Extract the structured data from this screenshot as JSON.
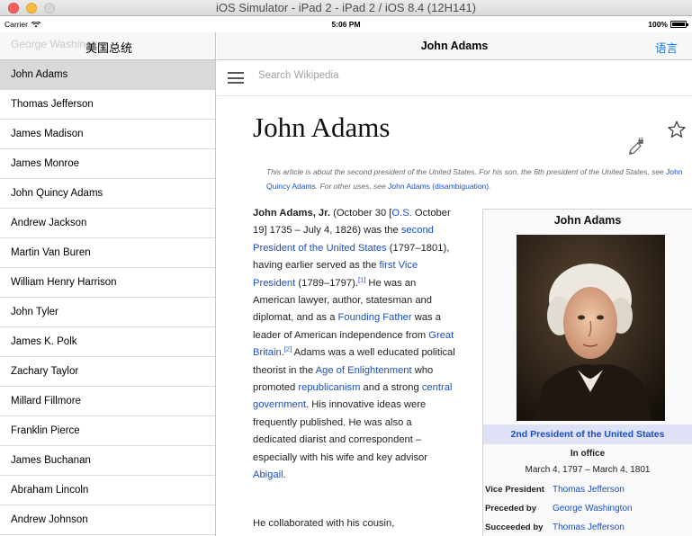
{
  "window": {
    "title": "iOS Simulator - iPad 2 - iPad 2 / iOS 8.4 (12H141)"
  },
  "status_bar": {
    "carrier": "Carrier",
    "time": "5:06 PM",
    "battery": "100%",
    "battery_level": 1.0
  },
  "master": {
    "back_title": "George Washington",
    "title": "美国总统",
    "items": [
      {
        "label": "John Adams",
        "selected": true
      },
      {
        "label": "Thomas Jefferson"
      },
      {
        "label": "James Madison"
      },
      {
        "label": "James Monroe"
      },
      {
        "label": "John Quincy Adams"
      },
      {
        "label": "Andrew Jackson"
      },
      {
        "label": "Martin Van Buren"
      },
      {
        "label": "William Henry Harrison"
      },
      {
        "label": "John Tyler"
      },
      {
        "label": "James K. Polk"
      },
      {
        "label": "Zachary Taylor"
      },
      {
        "label": "Millard Fillmore"
      },
      {
        "label": "Franklin Pierce"
      },
      {
        "label": "James Buchanan"
      },
      {
        "label": "Abraham Lincoln"
      },
      {
        "label": "Andrew Johnson"
      }
    ]
  },
  "detail": {
    "nav_title": "John Adams",
    "lang_button": "语言",
    "search_placeholder": "Search Wikipedia",
    "article_title": "John Adams",
    "hatnote": {
      "part1": "This article is about the second president of the United States. For his son, the 6th president of the United States, see ",
      "link1": "John Quincy Adams",
      "part2": ". For other uses, see ",
      "link2": "John Adams (disambiguation)",
      "part3": "."
    },
    "lead": {
      "bold_name": "John Adams, Jr.",
      "t1": " (October 30 [",
      "l_os": "O.S.",
      "t2": " October 19] 1735 – July 4, 1826) was the ",
      "l_second": "second President of the United States",
      "t3": " (1797–1801), having earlier served as the ",
      "l_vp": "first Vice President",
      "t4": " (1789–1797).",
      "ref1": "[1]",
      "t5": " He was an American lawyer, author, statesman and diplomat, and as a ",
      "l_ff": "Founding Father",
      "t6": " was a leader of American independence from ",
      "l_gb": "Great Britain",
      "t7": ".",
      "ref2": "[2]",
      "t8": " Adams was a well educated political theorist in the ",
      "l_age": "Age of Enlightenment",
      "t9": " who promoted ",
      "l_rep": "republicanism",
      "t10": " and a strong ",
      "l_cg": "central government",
      "t11": ". His innovative ideas were frequently published. He was also a dedicated diarist and correspondent – especially with his wife and key advisor ",
      "l_abigail": "Abigail",
      "t12": "."
    },
    "second_para": "He collaborated with his cousin,"
  },
  "infobox": {
    "name": "John Adams",
    "office": "2nd President of the United States",
    "in_office_label": "In office",
    "in_office_dates": "March 4, 1797 – March 4, 1801",
    "rows": [
      {
        "label": "Vice President",
        "value": "Thomas Jefferson"
      },
      {
        "label": "Preceded by",
        "value": "George Washington"
      },
      {
        "label": "Succeeded by",
        "value": "Thomas Jefferson"
      }
    ]
  },
  "colors": {
    "link": "#1a4fc4",
    "ios_tint": "#0a7aff",
    "selected_row": "#d9d9d9",
    "infobox_office_bg": "#dfe2f7"
  }
}
